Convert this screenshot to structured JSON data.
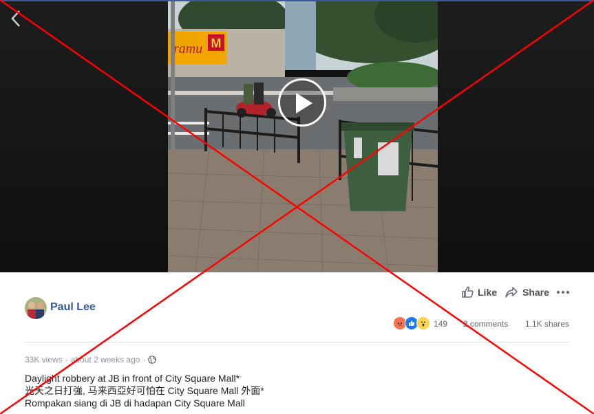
{
  "post": {
    "author": "Paul Lee",
    "actions": {
      "like": "Like",
      "share": "Share"
    },
    "reactions": {
      "count": "149",
      "comments": "2 comments",
      "shares": "1.1K shares"
    },
    "meta": {
      "views": "33K views",
      "separator": "·",
      "time": "about 2 weeks ago",
      "separator2": "·"
    },
    "caption": [
      "Daylight robbery at JB in front of City Square Mall*",
      "光天之日打強, 马来西亞好可怕在 City Square Mall 外面*",
      "Rompakan siang di JB di hadapan City Square Mall"
    ]
  },
  "video": {
    "sign_text": "ramu"
  },
  "icons": {
    "back": "chevron-left-icon",
    "play": "play-icon",
    "like": "thumbs-up-icon",
    "share": "share-arrow-icon",
    "more": "more-dots-icon",
    "privacy": "globe-icon"
  },
  "colors": {
    "accent": "#365899",
    "overlay_x": "#ff0000",
    "angry": "#f7714c",
    "like": "#1877f2",
    "wow": "#fcd34d"
  }
}
